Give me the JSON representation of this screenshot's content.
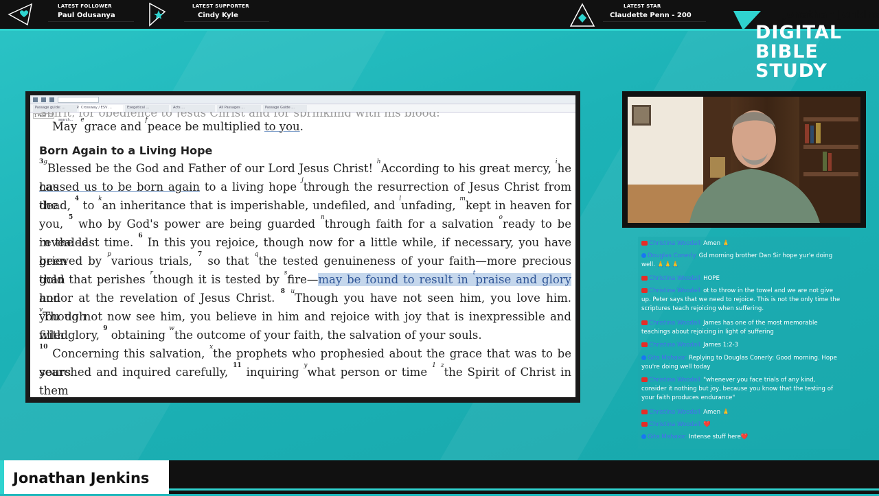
{
  "alerts": [
    {
      "label": "LATEST FOLLOWER",
      "value": "Paul Odusanya",
      "icon": "heart-icon"
    },
    {
      "label": "LATEST SUPPORTER",
      "value": "Cindy Kyle",
      "icon": "star-icon"
    },
    {
      "label": "LATEST STAR",
      "value": "Claudette Penn - 200",
      "icon": "diamond-icon"
    }
  ],
  "brand": {
    "name": "Jonathan Jenkins",
    "logo_line1": "DIGITAL",
    "logo_line2": "BIBLE",
    "logo_line3": "STUDY"
  },
  "bible": {
    "toolbar_search_placeholder": "Find passages or search...",
    "tabs": [
      "Passage guide: ...",
      "Crossway / ESV ...",
      "Exegetical ...",
      "Acts ...",
      "All Passages ...",
      "Passage Guide ..."
    ],
    "reference": "1 Peter 1:2",
    "cut_line": "Spirit, for obedience to Jesus Christ and for sprinkling with his blood:",
    "greeting": {
      "v1": "May ",
      "s1": "e",
      "t1": "grace and ",
      "s2": "f",
      "t2": "peace be multiplied ",
      "t3": "to you",
      "t4": "."
    },
    "heading": "Born Again to a Living Hope",
    "lines": [
      {
        "a": "3",
        "b": "g",
        "c": "Blessed be the God and Father of our Lord Jesus Christ! ",
        "d": "h",
        "e": "According to his great mercy, ",
        "f": "i",
        "g": "he has"
      },
      {
        "a": "caused us to be born again",
        "b": " to a living hope ",
        "c": "j",
        "d": "through the resurrection of Jesus Christ from the"
      },
      {
        "a": "dead, ",
        "b": "4",
        "c": " to ",
        "d": "k",
        "e": "an inheritance that is imperishable, undefiled, and ",
        "f": "l",
        "g": "unfading, ",
        "h": "m",
        "i": "kept in heaven for"
      },
      {
        "a": "you, ",
        "b": "5",
        "c": " who by God's power are being guarded ",
        "d": "n",
        "e": "through faith for a salvation ",
        "f": "o",
        "g": "ready to be revealed"
      },
      {
        "a": "in the last time. ",
        "b": "6",
        "c": " In this you rejoice, though now for a little while, if necessary, you have been"
      },
      {
        "a": "grieved by ",
        "b": "p",
        "c": "various trials, ",
        "d": "7",
        "e": " so that ",
        "f": "q",
        "g": "the tested genuineness of your faith—more precious than"
      },
      {
        "a": "gold that perishes ",
        "b": "r",
        "c": "though it is tested by ",
        "d": "s",
        "e": "fire—",
        "f": "may be found to result in ",
        "g": "t",
        "h": "praise and glory",
        "i": " and"
      },
      {
        "a": "honor at the revelation of Jesus Christ. ",
        "b": "8",
        "c": " ",
        "d": "u",
        "e": "Though you have not seen him, you love him. ",
        "f": "v",
        "g": "Though"
      },
      {
        "a": "you do not now see him, you believe in him and rejoice with joy that is inexpressible and filled"
      },
      {
        "a": "with glory, ",
        "b": "9",
        "c": " obtaining ",
        "d": "w",
        "e": "the outcome of your faith, the salvation of your souls."
      },
      {
        "a": "10",
        "b": " Concerning this salvation, ",
        "c": "x",
        "d": "the prophets who prophesied about the grace that was to be yours"
      },
      {
        "a": "searched and inquired carefully, ",
        "b": "11",
        "c": " inquiring ",
        "d": "y",
        "e": "what person or time ",
        "f": "1",
        "g": " ",
        "h": "z",
        "i": "the Spirit of Christ in them"
      }
    ]
  },
  "chat": [
    {
      "platform": "youtube",
      "user": "Christina Woodall",
      "text": "Amen 🙏"
    },
    {
      "platform": "facebook",
      "user": "Douglas Conerly",
      "text": "Gd morning brother Dan Sir hope yur'e doing well. 🙏🙏🙏"
    },
    {
      "platform": "youtube",
      "user": "Christina Woodall",
      "text": "HOPE"
    },
    {
      "platform": "youtube",
      "user": "Christina Woodall",
      "text": "ot to throw in the towel and we are not give up. Peter says that we need to rejoice. This is not the only time the scriptures teach rejoicing when suffering."
    },
    {
      "platform": "youtube",
      "user": "Christina Woodall",
      "text": "James has one of the most memorable teachings about rejoicing in light of suffering"
    },
    {
      "platform": "youtube",
      "user": "Christina Woodall",
      "text": "James 1:2-3"
    },
    {
      "platform": "facebook",
      "user": "Gita Mahaxic",
      "text": "Replying to Douglas Conerly: Good morning. Hope you're doing well today"
    },
    {
      "platform": "youtube",
      "user": "Christina Woodall",
      "text": "\"whenever you face trials of any kind, consider it nothing but joy, because you know that the testing of your faith produces endurance\""
    },
    {
      "platform": "youtube",
      "user": "Christina Woodall",
      "text": "Amen 🙏"
    },
    {
      "platform": "youtube",
      "user": "Christina Woodall",
      "text": "❤️"
    },
    {
      "platform": "facebook",
      "user": "Gita Mahaxic",
      "text": "Intense stuff here❤️"
    }
  ],
  "nameplate": "Jonathan Jenkins",
  "colors": {
    "accent": "#2fd3cf",
    "highlight": "#c5d7ec",
    "highlight_text": "#2f5597",
    "background": "#1fb8bc"
  }
}
